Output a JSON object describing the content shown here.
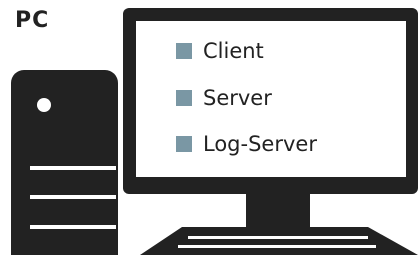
{
  "title": "PC",
  "colors": {
    "device": "#222222",
    "screen": "#ffffff",
    "bullet": "#7a97a4",
    "text": "#222222"
  },
  "screen_items": [
    {
      "label": "Client",
      "icon": "square-bullet"
    },
    {
      "label": "Server",
      "icon": "square-bullet"
    },
    {
      "label": "Log-Server",
      "icon": "square-bullet"
    }
  ]
}
